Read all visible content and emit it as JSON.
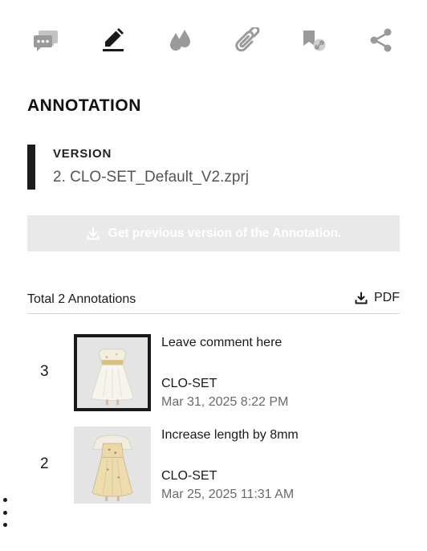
{
  "toolbar": {
    "tools": [
      "comments-icon",
      "annotation-pen-icon",
      "color-drops-icon",
      "attachment-clip-icon",
      "bookmark-link-icon",
      "share-icon"
    ],
    "active_tool": "annotation-pen-icon",
    "icon_color": "#9a9a9a",
    "active_color": "#1a1a1a"
  },
  "panel": {
    "title": "ANNOTATION"
  },
  "version": {
    "label": "VERSION",
    "value": "2. CLO-SET_Default_V2.zprj"
  },
  "previous_button": {
    "label": "Get previous version of the Annotation.",
    "state": "disabled"
  },
  "summary": {
    "total_label": "Total 2 Annotations",
    "pdf_label": "PDF"
  },
  "annotations": [
    {
      "number": "3",
      "comment": "Leave comment here",
      "author": "CLO-SET",
      "date": "Mar 31, 2025 8:22 PM",
      "selected": true,
      "garment_color": "#f1efe6"
    },
    {
      "number": "2",
      "comment": "Increase length by 8mm",
      "author": "CLO-SET",
      "date": "Mar 25, 2025 11:31 AM",
      "selected": false,
      "garment_color": "#ecdcae"
    }
  ],
  "menu": {
    "icon": "vertical-more-icon"
  }
}
